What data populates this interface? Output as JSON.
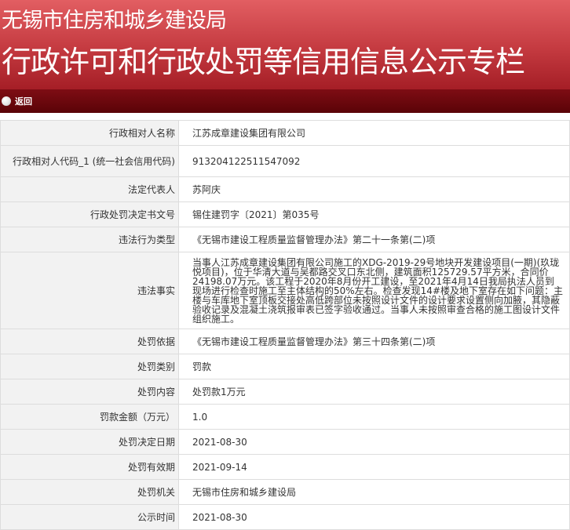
{
  "header": {
    "line1": "无锡市住房和城乡建设局",
    "line2": "行政许可和行政处罚等信用信息公示专栏"
  },
  "nav": {
    "back_label": "返回"
  },
  "rows": [
    {
      "label": "行政相对人名称",
      "value": "江苏成章建设集团有限公司"
    },
    {
      "label": "行政相对人代码_1 (统一社会信用代码)",
      "value": "913204122511547092"
    },
    {
      "label": "法定代表人",
      "value": "苏阿庆"
    },
    {
      "label": "行政处罚决定书文号",
      "value": "锡住建罚字〔2021〕第035号"
    },
    {
      "label": "违法行为类型",
      "value": "《无锡市建设工程质量监督管理办法》第二十一条第(二)项"
    },
    {
      "label": "违法事实",
      "value": "当事人江苏成章建设集团有限公司施工的XDG-2019-29号地块开发建设项目(一期)(玖珑悦项目)，位于华清大道与吴都路交叉口东北侧，建筑面积125729.57平方米，合同价24198.07万元。该工程于2020年8月份开工建设，至2021年4月14日我局执法人员到现场进行检查时施工至主体结构的50%左右。检查发现14#楼及地下室存在如下问题：主楼与车库地下室顶板交接处高低跨部位未按照设计文件的设计要求设置侧向加腋，其隐蔽验收记录及混凝土浇筑报审表已签字验收通过。当事人未按照审查合格的施工图设计文件组织施工。"
    },
    {
      "label": "处罚依据",
      "value": "《无锡市建设工程质量监督管理办法》第三十四条第(二)项"
    },
    {
      "label": "处罚类别",
      "value": "罚款"
    },
    {
      "label": "处罚内容",
      "value": "处罚款1万元"
    },
    {
      "label": "罚款金额（万元）",
      "value": "1.0"
    },
    {
      "label": "处罚决定日期",
      "value": "2021-08-30"
    },
    {
      "label": "处罚有效期",
      "value": "2021-09-14"
    },
    {
      "label": "处罚机关",
      "value": "无锡市住房和城乡建设局"
    },
    {
      "label": "公示时间",
      "value": "2021-08-30"
    }
  ]
}
